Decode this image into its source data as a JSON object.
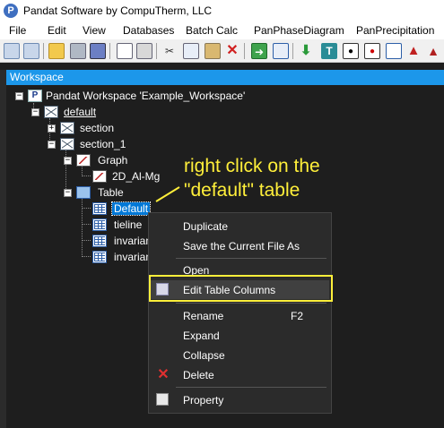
{
  "window": {
    "title": "Pandat Software by CompuTherm, LLC",
    "app_icon_letter": "P"
  },
  "menu": [
    "File",
    "Edit",
    "View",
    "Databases",
    "Batch Calc",
    "PanPhaseDiagram",
    "PanPrecipitation"
  ],
  "toolbar": {
    "buttons": [
      "new-workspace",
      "open-workspace",
      "open-folder",
      "save",
      "save-all",
      "print-preview",
      "print",
      "cut",
      "copy",
      "paste",
      "delete",
      "import",
      "export",
      "download",
      "text",
      "point",
      "line",
      "envelope",
      "warning",
      "precipitation"
    ]
  },
  "workspace": {
    "header": "Workspace",
    "root": "Pandat Workspace 'Example_Workspace'",
    "default_folder": "default",
    "section": "section",
    "section_1": "section_1",
    "graph": "Graph",
    "graph_item": "2D_Al-Mg",
    "table": "Table",
    "tables": [
      "Default",
      "tieline",
      "invarian",
      "invarian"
    ]
  },
  "annotation": {
    "line1": "right click on the",
    "line2": "\"default\" table"
  },
  "context_menu": {
    "items": [
      {
        "label": "Duplicate",
        "icon": ""
      },
      {
        "label": "Save the Current File As",
        "icon": ""
      },
      {
        "label": "Open",
        "icon": ""
      },
      {
        "label": "Edit Table Columns",
        "icon": "edit-table-icon"
      },
      {
        "label": "Rename",
        "shortcut": "F2",
        "icon": ""
      },
      {
        "label": "Expand",
        "icon": ""
      },
      {
        "label": "Collapse",
        "icon": ""
      },
      {
        "label": "Delete",
        "icon": "delete-icon"
      },
      {
        "label": "Property",
        "icon": "property-icon"
      }
    ]
  },
  "colors": {
    "panel_header": "#1c97ea",
    "annotation": "#ffef3a",
    "selection": "#0078d7",
    "delete_red": "#e03030"
  }
}
